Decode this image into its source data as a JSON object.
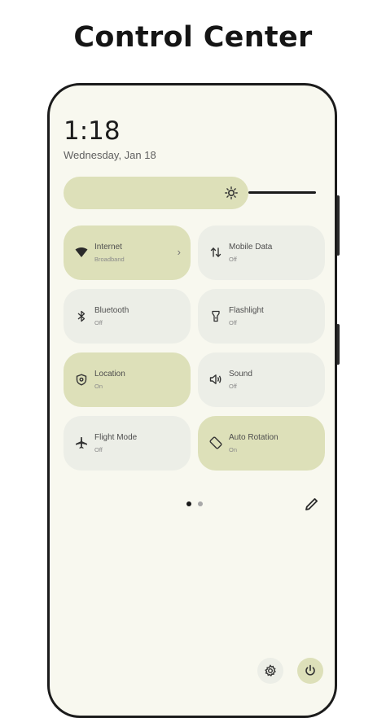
{
  "headline": "Control Center",
  "status": {
    "time": "1:18",
    "date": "Wednesday, Jan 18"
  },
  "brightness": {
    "level": 0.62,
    "icon": "brightness-icon"
  },
  "tiles": [
    {
      "title": "Internet",
      "subtitle": "Broadband",
      "active": true,
      "icon": "wifi-icon",
      "has_chevron": true
    },
    {
      "title": "Mobile Data",
      "subtitle": "Off",
      "active": false,
      "icon": "mobile-data-icon"
    },
    {
      "title": "Bluetooth",
      "subtitle": "Off",
      "active": false,
      "icon": "bluetooth-icon"
    },
    {
      "title": "Flashlight",
      "subtitle": "Off",
      "active": false,
      "icon": "flashlight-icon"
    },
    {
      "title": "Location",
      "subtitle": "On",
      "active": true,
      "icon": "location-icon"
    },
    {
      "title": "Sound",
      "subtitle": "Off",
      "active": false,
      "icon": "sound-icon"
    },
    {
      "title": "Flight Mode",
      "subtitle": "Off",
      "active": false,
      "icon": "airplane-icon"
    },
    {
      "title": "Auto Rotation",
      "subtitle": "On",
      "active": true,
      "icon": "auto-rotate-icon"
    }
  ],
  "chevron_glyph": "›",
  "pager": {
    "pages": 2,
    "current": 1
  },
  "colors": {
    "panel_bg": "#f8f8ef",
    "tile_on": "#dde0b9",
    "tile_off": "#eceee7",
    "dot_active": "#1a1a1a",
    "dot_inactive": "#a8a8a8"
  }
}
